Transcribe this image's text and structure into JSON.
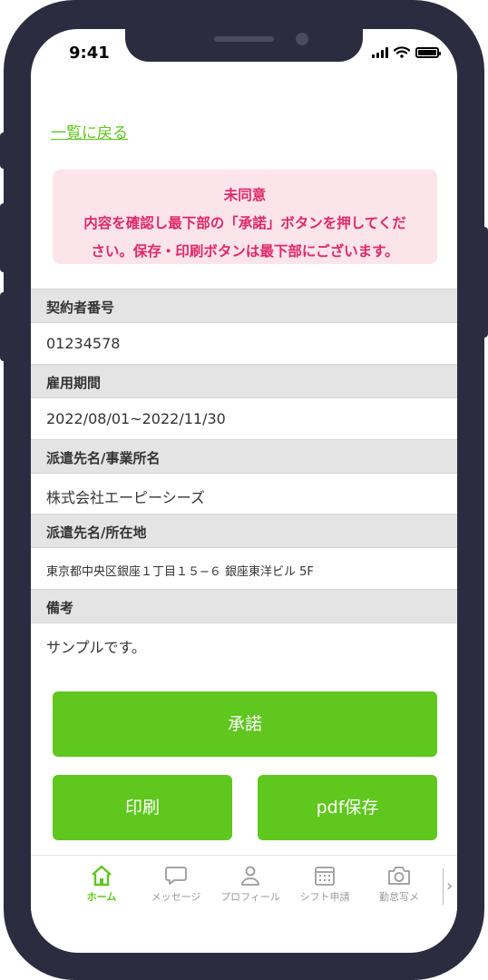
{
  "status": {
    "time": "9:41"
  },
  "nav": {
    "back_label": "一覧に戻る"
  },
  "notice": {
    "title": "未同意",
    "line2": "内容を確認し最下部の「承諾」ボタンを押してくだ",
    "line3": "さい。保存・印刷ボタンは最下部にございます。"
  },
  "fields": [
    {
      "label": "契約者番号",
      "value": "01234578"
    },
    {
      "label": "雇用期間",
      "value": "2022/08/01~2022/11/30"
    },
    {
      "label": "派遣先名/事業所名",
      "value": "株式会社エーピーシーズ"
    },
    {
      "label": "派遣先名/所在地",
      "value": "東京都中央区銀座１丁目１５−６ 銀座東洋ビル 5F"
    },
    {
      "label": "備考",
      "value": "サンプルです。"
    }
  ],
  "actions": {
    "accept_label": "承諾",
    "print_label": "印刷",
    "pdf_label": "pdf保存"
  },
  "tabbar": {
    "items": [
      {
        "label": "ホーム",
        "icon": "home-icon",
        "active": true
      },
      {
        "label": "メッセージ",
        "icon": "chat-bubble-icon"
      },
      {
        "label": "プロフィール",
        "icon": "person-icon"
      },
      {
        "label": "シフト申請",
        "icon": "calendar-icon"
      },
      {
        "label": "勤怠写メ",
        "icon": "camera-icon"
      }
    ],
    "more_icon": "chevron-right-icon"
  },
  "colors": {
    "accent": "#5fc71e",
    "notice_bg": "#fbe4ea",
    "notice_text": "#e0296a",
    "frame": "#2b2c3f"
  }
}
